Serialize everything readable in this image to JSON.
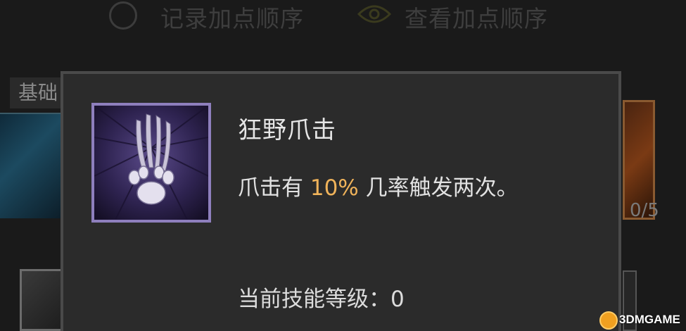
{
  "header": {
    "record_order_label": "记录加点顺序",
    "view_order_label": "查看加点顺序"
  },
  "background": {
    "tab_label": "基础",
    "right_skill_count": "0/5"
  },
  "tooltip": {
    "skill_name": "狂野爪击",
    "description_prefix": "爪击有 ",
    "description_highlight": "10%",
    "description_suffix": " 几率触发两次。",
    "current_level_label": "当前技能等级：",
    "current_level_value": "0",
    "icon": "wolf-claw-icon"
  },
  "watermark": {
    "text": "3DMGAME"
  },
  "colors": {
    "highlight": "#f0b35a",
    "icon_border": "#8e7fbd",
    "panel": "#2b2b2b"
  }
}
